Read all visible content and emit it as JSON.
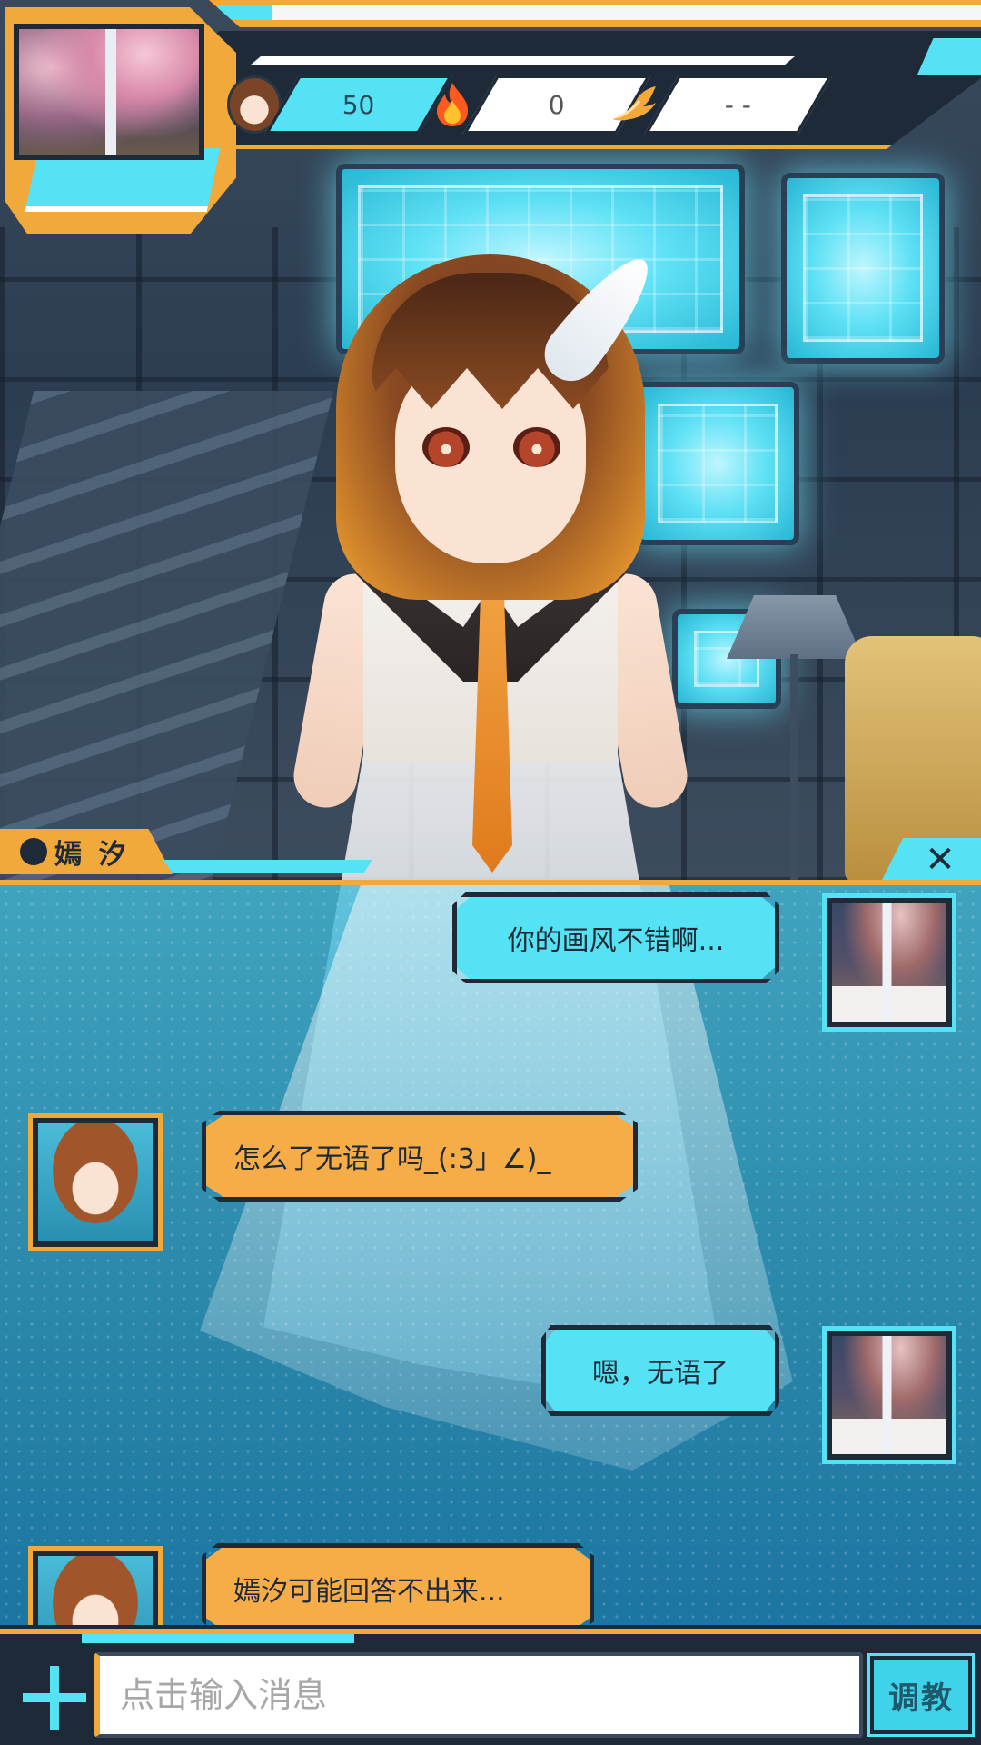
{
  "hud": {
    "affection_value": "50",
    "fire_value": "0",
    "wing_value": "- -",
    "icons": [
      "character-avatar-icon",
      "fire-icon",
      "wing-icon"
    ]
  },
  "character": {
    "name": "嫣 汐"
  },
  "chat": {
    "messages": [
      {
        "from": "user",
        "text": "你的画风不错啊..."
      },
      {
        "from": "bot",
        "text": "怎么了无语了吗_(:3」∠)_"
      },
      {
        "from": "user",
        "text": "嗯，无语了"
      },
      {
        "from": "bot",
        "text": "嫣汐可能回答不出来..."
      }
    ]
  },
  "input": {
    "placeholder": "点击输入消息",
    "train_label": "调教"
  },
  "colors": {
    "accent_orange": "#f2a93b",
    "accent_cyan": "#56e2f5",
    "frame_dark": "#1e2a38"
  }
}
